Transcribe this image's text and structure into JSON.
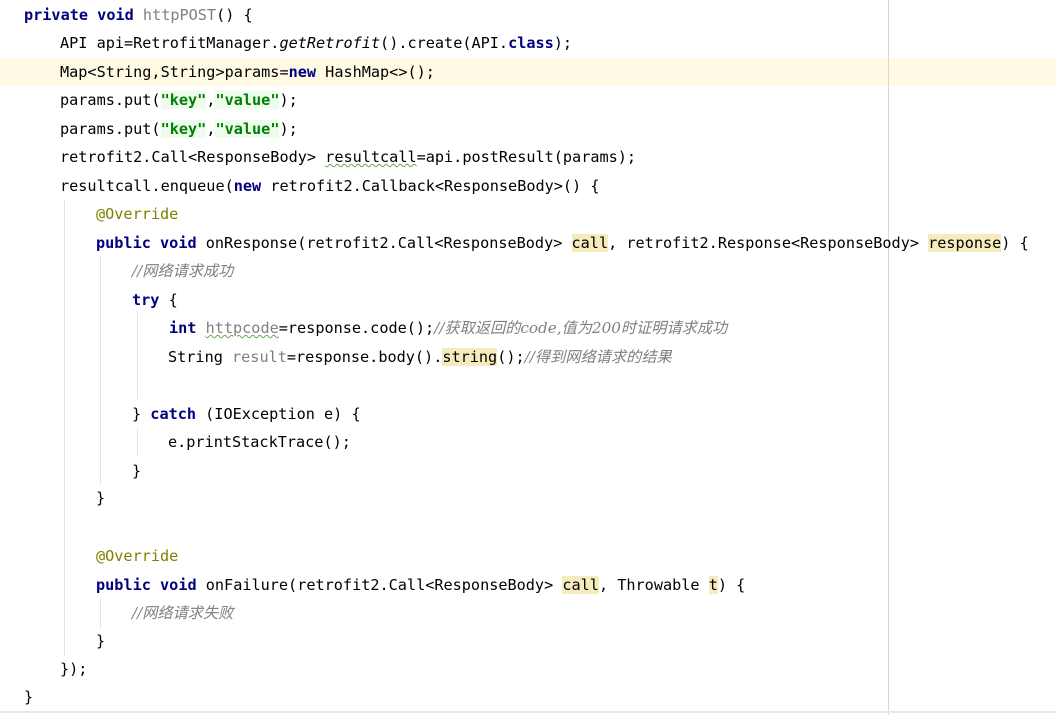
{
  "code": {
    "l1": {
      "kw1": "private",
      "kw2": "void",
      "method": "httpPOST",
      "tail": "() {"
    },
    "l2": {
      "pre": "API api=RetrofitManager.",
      "call": "getRetrofit",
      "mid": "().create(API.",
      "kw": "class",
      "tail": ");"
    },
    "l3": {
      "pre": "Map<String,String>params=",
      "kw": "new",
      "tail": " HashMap<>();"
    },
    "l4": {
      "pre": "params.put(",
      "s1": "\"key\"",
      "sep": ",",
      "s2": "\"value\"",
      "tail": ");"
    },
    "l5": {
      "pre": "params.put(",
      "s1": "\"key\"",
      "sep": ",",
      "s2": "\"value\"",
      "tail": ");"
    },
    "l6": {
      "pre": "retrofit2.Call<ResponseBody> ",
      "var": "resultcall",
      "tail": "=api.postResult(params);"
    },
    "l7": {
      "pre": "resultcall.enqueue(",
      "kw": "new",
      "tail": " retrofit2.Callback<ResponseBody>() {"
    },
    "l8": {
      "ann": "@Override"
    },
    "l9": {
      "kw1": "public",
      "kw2": "void",
      "pre": "onResponse(retrofit2.Call<ResponseBody> ",
      "p1": "call",
      "mid": ", retrofit2.Response<ResponseBody> ",
      "p2": "response",
      "tail": ") {"
    },
    "l10": {
      "cmt": "//网络请求成功"
    },
    "l11": {
      "kw": "try",
      "tail": " {"
    },
    "l12": {
      "kw": "int",
      "var": "httpcode",
      "pre": "=response.code();",
      "cmt": "//获取返回的code,值为200时证明请求成功"
    },
    "l13": {
      "pre": "String ",
      "var": "result",
      "mid": "=response.body().",
      "hl": "string",
      "tail": "();",
      "cmt": "//得到网络请求的结果"
    },
    "l15": {
      "pre": "} ",
      "kw": "catch",
      "tail": " (IOException e) {"
    },
    "l16": {
      "text": "e.printStackTrace();"
    },
    "l17": {
      "text": "}"
    },
    "l18": {
      "text": "}"
    },
    "l20": {
      "ann": "@Override"
    },
    "l21": {
      "kw1": "public",
      "kw2": "void",
      "pre": "onFailure(retrofit2.Call<ResponseBody> ",
      "p1": "call",
      "mid": ", Throwable ",
      "p2": "t",
      "tail": ") {"
    },
    "l22": {
      "cmt": "//网络请求失败"
    },
    "l23": {
      "text": "}"
    },
    "l24": {
      "text": "});"
    },
    "l25": {
      "text": "}"
    }
  },
  "colors": {
    "keyword": "#000080",
    "string": "#008000",
    "annotation": "#808000",
    "comment": "#808080",
    "highlight": "#f6ebbc",
    "current_line": "#fffae3"
  }
}
